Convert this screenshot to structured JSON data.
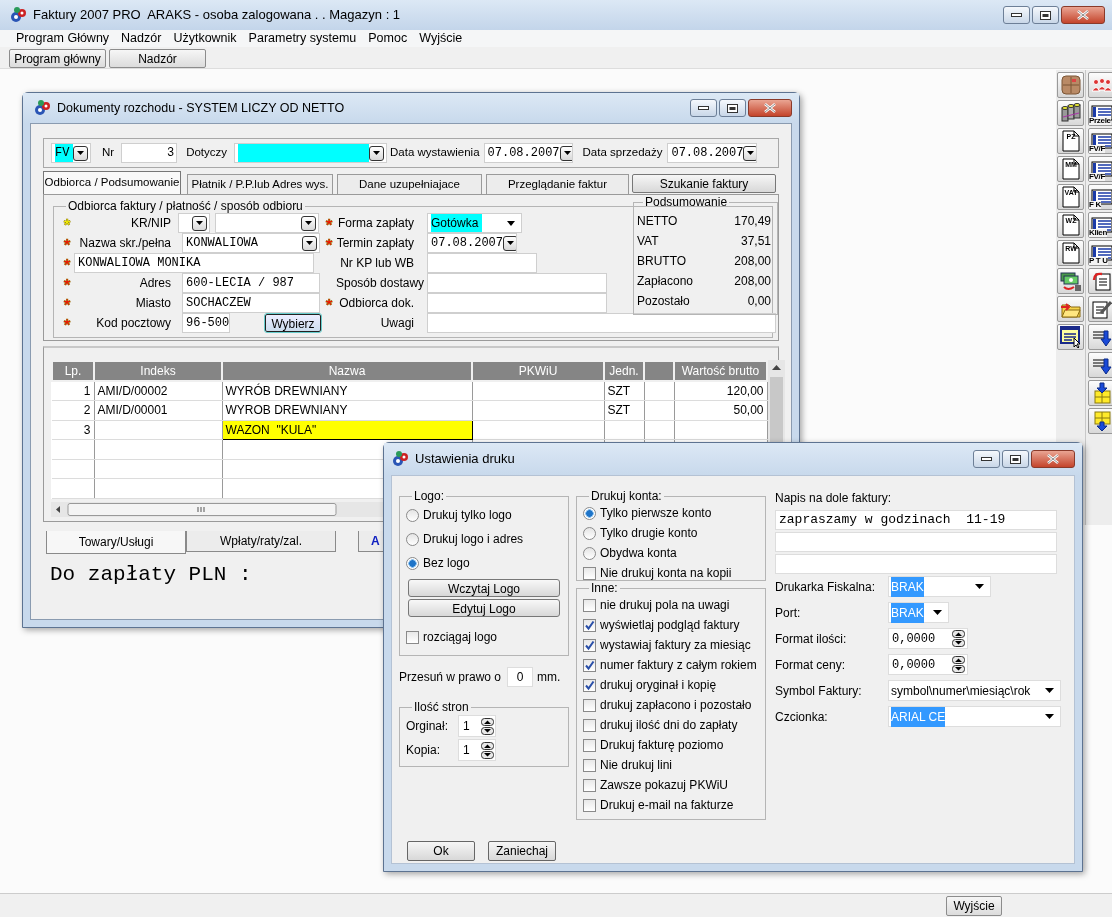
{
  "app": {
    "title": "Faktury 2007 PRO  ARAKS - osoba zalogowana . . Magazyn : 1",
    "menu": [
      "Program Główny",
      "Nadzór",
      "Użytkownik",
      "Parametry systemu",
      "Pomoc",
      "Wyjście"
    ],
    "toolbar": [
      "Program główny",
      "Nadzór"
    ],
    "side_toolbar": {
      "column_1": [
        {
          "kind": "box"
        },
        {
          "kind": "database"
        },
        {
          "kind": "doc",
          "label": "PZ"
        },
        {
          "kind": "doc",
          "label": "MM"
        },
        {
          "kind": "doc",
          "label": "VAT"
        },
        {
          "kind": "doc",
          "label": "WZ"
        },
        {
          "kind": "doc",
          "label": "RW"
        },
        {
          "kind": "money"
        },
        {
          "kind": "folder"
        },
        {
          "kind": "form"
        }
      ],
      "column_2": [
        {
          "kind": "people"
        },
        {
          "kind": "list",
          "label": "Przele"
        },
        {
          "kind": "list",
          "label": "FV/F"
        },
        {
          "kind": "list",
          "label": "FV/F"
        },
        {
          "kind": "list",
          "label": "F K"
        },
        {
          "kind": "list",
          "label": "Klien"
        },
        {
          "kind": "list",
          "label": "P T U"
        },
        {
          "kind": "doc-arrow"
        },
        {
          "kind": "doc-pen"
        },
        {
          "kind": "download"
        },
        {
          "kind": "download"
        },
        {
          "kind": "grid-down"
        },
        {
          "kind": "grid-up"
        }
      ]
    },
    "status_bar": {
      "button": "Wyjście"
    }
  },
  "documents_window": {
    "title": "Dokumenty rozchodu - SYSTEM LICZY OD NETTO",
    "header": {
      "type": "FV",
      "nr_label": "Nr",
      "nr": "3",
      "dotyczy_label": "Dotyczy",
      "issue_label": "Data wystawienia",
      "issue_date": "07.08.2007",
      "sale_label": "Data sprzedaży",
      "sale_date": "07.08.2007"
    },
    "tabs": [
      {
        "kind": "tab",
        "label": "Odbiorca / Podsumowanie",
        "selected": true
      },
      {
        "kind": "tab",
        "label": "Płatnik / P.P.lub Adres wys.",
        "selected": false
      },
      {
        "kind": "tab",
        "label": "Dane uzupełniajace",
        "selected": false
      },
      {
        "kind": "tab",
        "label": "Przeglądanie faktur",
        "selected": false
      },
      {
        "kind": "button",
        "label": "Szukanie faktury"
      }
    ],
    "recipient": {
      "legend": "Odbiorca faktury / płatność / sposób odbioru",
      "left": [
        {
          "kind": "nip",
          "label": "KR/NIP",
          "star": "*",
          "color": "#ffff00"
        },
        {
          "kind": "combo",
          "label": "Nazwa skr./pełna",
          "star": "*",
          "color": "#ff0000",
          "value": "KONWALIOWA"
        },
        {
          "kind": "full",
          "star": "*",
          "color": "#ff0000",
          "value": "KONWALIOWA MONIKA"
        },
        {
          "kind": "text",
          "label": "Adres",
          "star": "*",
          "color": "#ff0000",
          "value": "600-LECIA / 987"
        },
        {
          "kind": "text",
          "label": "Miasto",
          "star": "*",
          "color": "#ff0000",
          "value": "SOCHACZEW"
        },
        {
          "kind": "button",
          "label": "Kod pocztowy",
          "star": "*",
          "color": "#ff0000",
          "value": "96-500",
          "button": "Wybierz"
        }
      ],
      "right": [
        {
          "kind": "select",
          "label": "Forma zapłaty",
          "star": "*",
          "color": "#ff0000",
          "value": "Gotówka"
        },
        {
          "kind": "date",
          "label": "Termin zapłaty",
          "star": "*",
          "color": "#ff0000",
          "value": "07.08.2007"
        },
        {
          "kind": "short",
          "label": "Nr KP lub WB"
        },
        {
          "kind": "text",
          "label": "Sposób dostawy"
        },
        {
          "kind": "text",
          "label": "Odbiorca dok.",
          "star": "*",
          "color": "#ff0000"
        },
        {
          "kind": "wide",
          "label": "Uwagi"
        }
      ]
    },
    "summary": {
      "title": "Podsumowanie",
      "rows": [
        {
          "label": "NETTO",
          "value": "170,49"
        },
        {
          "label": "VAT",
          "value": "37,51"
        },
        {
          "label": "BRUTTO",
          "value": "208,00"
        },
        {
          "label": "Zapłacono",
          "value": "208,00"
        },
        {
          "label": "Pozostało",
          "value": "0,00"
        }
      ]
    },
    "table": {
      "columns": [
        "Lp.",
        "Indeks",
        "Nazwa",
        "PKWiU",
        "Jedn.",
        null,
        "Wartość brutto"
      ],
      "rows": [
        {
          "cells": [
            "1",
            "AMI/D/00002",
            "WYRÓB DREWNIANY",
            "",
            "SZT",
            "",
            "120,00"
          ],
          "selected": false
        },
        {
          "cells": [
            "2",
            "AMI/D/00001",
            "WYROB DREWNIANY",
            "",
            "SZT",
            "",
            "50,00"
          ],
          "selected": false
        },
        {
          "cells": [
            "3",
            "",
            "WAZON  \"KULA\"",
            "",
            "",
            "",
            ""
          ],
          "selected": true
        }
      ]
    },
    "bottom_tabs": [
      {
        "label": "Towary/Usługi",
        "selected": true,
        "highlighted": false
      },
      {
        "label": "Wpłaty/raty/zal.",
        "selected": false,
        "highlighted": false
      },
      {
        "label": "A",
        "selected": false,
        "highlighted": true
      }
    ],
    "total_label": "Do zapłaty PLN :"
  },
  "print_dialog": {
    "title": "Ustawienia druku",
    "logo": {
      "legend": "Logo:",
      "options": [
        {
          "label": "Drukuj tylko logo",
          "selected": false
        },
        {
          "label": "Drukuj logo i adres",
          "selected": false
        },
        {
          "label": "Bez logo",
          "selected": true
        }
      ],
      "buttons": [
        "Wczytaj Logo",
        "Edytuj Logo"
      ],
      "stretch": {
        "label": "rozciągaj logo",
        "checked": false
      }
    },
    "shift": {
      "label": "Przesuń w prawo o",
      "value": "0",
      "unit": "mm."
    },
    "pages": {
      "legend": "Ilość stron",
      "rows": [
        {
          "label": "Orginał:",
          "value": "1"
        },
        {
          "label": "Kopia:",
          "value": "1"
        }
      ]
    },
    "accounts": {
      "legend": "Drukuj konta:",
      "options": [
        {
          "label": "Tylko pierwsze konto",
          "selected": true
        },
        {
          "label": "Tylko drugie konto",
          "selected": false
        },
        {
          "label": "Obydwa konta",
          "selected": false
        }
      ],
      "no_copy": {
        "label": "Nie drukuj konta na kopii",
        "checked": false
      }
    },
    "other": {
      "legend": "Inne:",
      "items": [
        {
          "label": "nie drukuj pola na uwagi",
          "checked": false
        },
        {
          "label": "wyświetlaj podgląd faktury",
          "checked": true
        },
        {
          "label": "wystawiaj faktury za miesiąc",
          "checked": true
        },
        {
          "label": "numer faktury z całym rokiem",
          "checked": true
        },
        {
          "label": "drukuj oryginał i kopię",
          "checked": true
        },
        {
          "label": "drukuj zapłacono i pozostało",
          "checked": false
        },
        {
          "label": "drukuj ilość dni do zapłaty",
          "checked": false
        },
        {
          "label": "Drukuj fakturę poziomo",
          "checked": false
        },
        {
          "label": "Nie drukuj lini",
          "checked": false
        },
        {
          "label": "Zawsze pokazuj PKWiU",
          "checked": false
        },
        {
          "label": "Drukuj e-mail na fakturze",
          "checked": false
        }
      ]
    },
    "footer": {
      "label": "Napis na dole faktury:",
      "lines": [
        "zapraszamy w godzinach  11-19"
      ]
    },
    "settings": [
      {
        "kind": "select",
        "label": "Drukarka Fiskalna:",
        "value": "BRAK",
        "highlighted": true
      },
      {
        "kind": "select_short",
        "label": "Port:",
        "value": "BRAK",
        "highlighted": true
      },
      {
        "kind": "spin",
        "label": "Format ilości:",
        "value": "0,0000"
      },
      {
        "kind": "spin",
        "label": "Format ceny:",
        "value": "0,0000"
      },
      {
        "kind": "select_wide",
        "label": "Symbol Faktury:",
        "value": "symbol\\numer\\miesiąc\\rok",
        "highlighted": false
      },
      {
        "kind": "select_wide",
        "label": "Czcionka:",
        "value": "ARIAL CE",
        "highlighted": true
      }
    ],
    "buttons": [
      "Ok",
      "Zaniechaj"
    ]
  }
}
